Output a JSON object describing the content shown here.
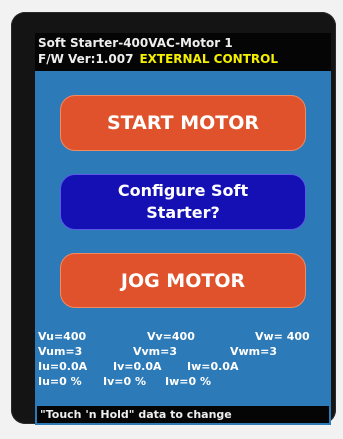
{
  "header": {
    "title": "Soft Starter-400VAC-Motor 1",
    "firmware": "F/W Ver:1.007",
    "mode": "EXTERNAL CONTROL"
  },
  "buttons": {
    "start": "START MOTOR",
    "configure_line1": "Configure Soft",
    "configure_line2": "Starter?",
    "jog": "JOG MOTOR"
  },
  "readings": {
    "vu": "Vu=400",
    "vv": "Vv=400",
    "vw": "Vw= 400",
    "vum": "Vum=3",
    "vvm": "Vvm=3",
    "vwm": "Vwm=3",
    "iu": "Iu=0.0A",
    "iv": "Iv=0.0A",
    "iw": "Iw=0.0A",
    "iup": "Iu=0 %",
    "ivp": "Iv=0 %",
    "iwp": "Iw=0 %"
  },
  "hint": "\"Touch 'n Hold\" data to change",
  "colors": {
    "screen_bg": "#2d7ab8",
    "bar_bg": "#050505",
    "accent_yellow": "#f4f000",
    "button_red": "#e0522c",
    "button_blue": "#1410b4"
  }
}
